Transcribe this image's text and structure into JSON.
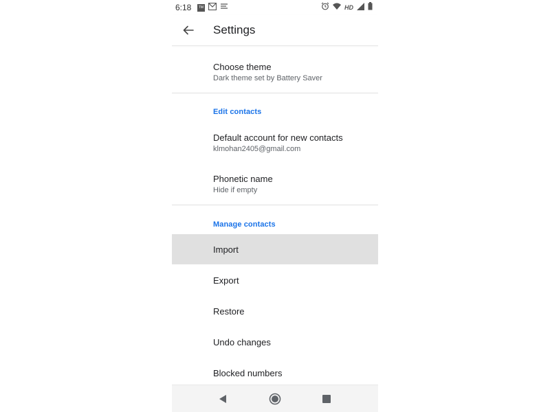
{
  "status_bar": {
    "time": "6:18",
    "left_icons": [
      "tv-badge-icon",
      "mail-image-icon",
      "cast-icon"
    ],
    "right_icons": [
      "alarm-icon",
      "wifi-icon",
      "signal-icon",
      "battery-icon"
    ],
    "hd_label": "HD"
  },
  "app_bar": {
    "title": "Settings",
    "back_icon": "arrow-back-icon"
  },
  "items": {
    "choose_theme": {
      "primary": "Choose theme",
      "secondary": "Dark theme set by Battery Saver"
    },
    "edit_contacts_header": "Edit contacts",
    "default_account": {
      "primary": "Default account for new contacts",
      "secondary": "klmohan2405@gmail.com"
    },
    "phonetic_name": {
      "primary": "Phonetic name",
      "secondary": "Hide if empty"
    },
    "manage_contacts_header": "Manage contacts",
    "import": "Import",
    "export": "Export",
    "restore": "Restore",
    "undo_changes": "Undo changes",
    "blocked_numbers": "Blocked numbers"
  },
  "nav_bar": {
    "back_icon": "nav-back-triangle-icon",
    "home_icon": "nav-home-circle-icon",
    "recents_icon": "nav-recents-square-icon"
  },
  "colors": {
    "accent": "#1a73e8",
    "highlight": "#e0e0e0",
    "text_primary": "#202124",
    "text_secondary": "#5f6368"
  }
}
